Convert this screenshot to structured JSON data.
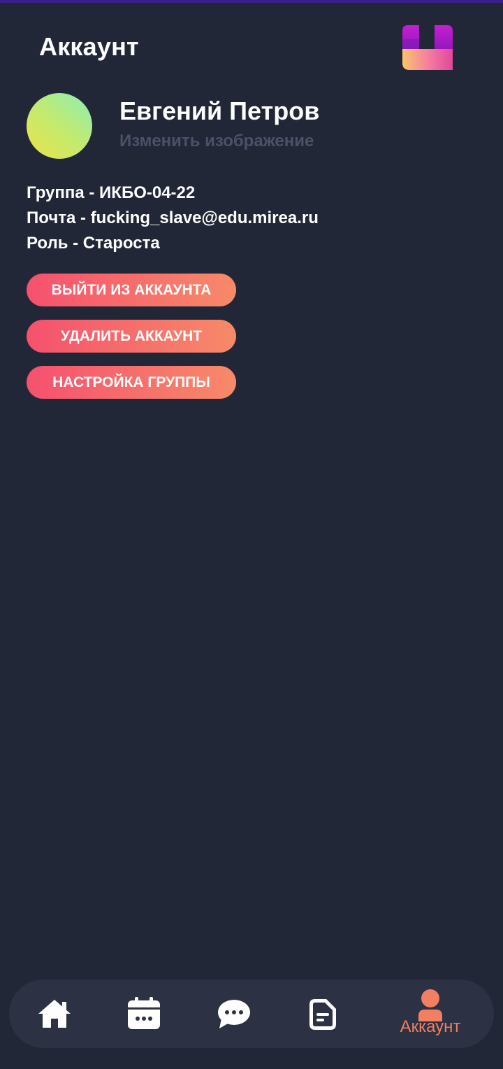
{
  "header": {
    "title": "Аккаунт",
    "logo_icon": "app-logo-icon"
  },
  "profile": {
    "name": "Евгений Петров",
    "change_photo_label": "Изменить изображение",
    "group_line": "Группа - ИКБО-04-22",
    "email_line": "Почта - fucking_slave@edu.mirea.ru",
    "role_line": "Роль - Староста"
  },
  "actions": {
    "logout_label": "ВЫЙТИ ИЗ АККАУНТА",
    "delete_label": "УДАЛИТЬ АККАУНТ",
    "group_settings_label": "НАСТРОЙКА ГРУППЫ"
  },
  "bottom_nav": {
    "items": [
      {
        "icon": "home-icon",
        "label": ""
      },
      {
        "icon": "calendar-icon",
        "label": ""
      },
      {
        "icon": "chat-icon",
        "label": ""
      },
      {
        "icon": "document-icon",
        "label": ""
      },
      {
        "icon": "user-icon",
        "label": "Аккаунт",
        "active": true
      }
    ]
  },
  "colors": {
    "background": "#222737",
    "nav_background": "#2c3143",
    "accent_start": "#f5516e",
    "accent_end": "#f78a69",
    "active_nav": "#f27f61",
    "muted_text": "#4a5168"
  }
}
